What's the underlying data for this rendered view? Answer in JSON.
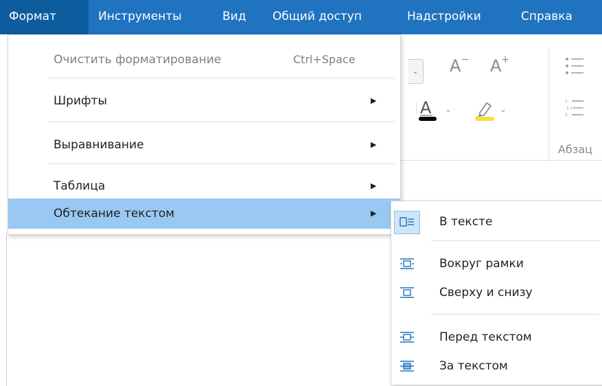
{
  "menubar": {
    "items": [
      {
        "label": "Формат",
        "active": true
      },
      {
        "label": "Инструменты",
        "active": false
      },
      {
        "label": "Вид",
        "active": false
      },
      {
        "label": "Общий доступ",
        "active": false
      },
      {
        "label": "Надстройки",
        "active": false
      },
      {
        "label": "Справка",
        "active": false
      }
    ]
  },
  "ribbon": {
    "font_decrease_label": "A",
    "font_decrease_sup": "−",
    "font_increase_label": "A",
    "font_increase_sup": "+",
    "paragraph_group_label": "Абзац",
    "text_color_label": "A",
    "text_color": "#000000",
    "highlight_color": "#f4e13a"
  },
  "format_menu": {
    "items": [
      {
        "label": "Очистить форматирование",
        "shortcut": "Ctrl+Space"
      },
      {
        "label": "Шрифты"
      },
      {
        "label": "Выравнивание"
      },
      {
        "label": "Таблица"
      },
      {
        "label": "Обтекание текстом"
      }
    ],
    "submenu_arrow": "▶"
  },
  "text_wrap_submenu": {
    "items": [
      {
        "label": "В тексте",
        "icon": "wrap-inline-icon",
        "checked": true
      },
      {
        "label": "Вокруг рамки",
        "icon": "wrap-square-icon"
      },
      {
        "label": "Сверху и снизу",
        "icon": "wrap-top-bottom-icon"
      },
      {
        "label": "Перед текстом",
        "icon": "wrap-in-front-icon"
      },
      {
        "label": "За текстом",
        "icon": "wrap-behind-icon"
      }
    ]
  },
  "colors": {
    "menubar_bg": "#1f73bf",
    "menubar_active_bg": "#0d5c9e",
    "menu_highlight": "#99c9f2",
    "icon_blue": "#1f73bf"
  }
}
